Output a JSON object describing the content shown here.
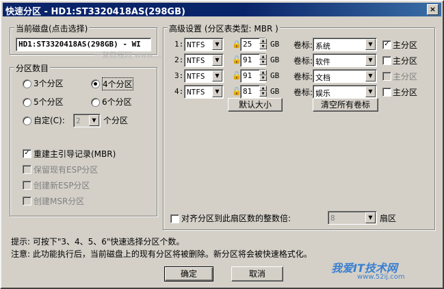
{
  "window": {
    "title": "快速分区 - HD1:ST3320418AS(298GB)",
    "close_glyph": "×"
  },
  "disk_group": {
    "legend": "当前磁盘(点击选择)",
    "value": "HD1:ST3320418AS(298GB) - WI"
  },
  "count_group": {
    "legend": "分区数目",
    "options": [
      "3个分区",
      "4个分区",
      "5个分区",
      "6个分区"
    ],
    "selected_index": 1,
    "custom_label": "自定(C):",
    "custom_value": "2",
    "custom_suffix": "个分区",
    "checks": [
      {
        "label": "重建主引导记录(MBR)",
        "checked": true,
        "enabled": true
      },
      {
        "label": "保留现有ESP分区",
        "checked": false,
        "enabled": false
      },
      {
        "label": "创建新ESP分区",
        "checked": false,
        "enabled": false
      },
      {
        "label": "创建MSR分区",
        "checked": false,
        "enabled": false
      }
    ]
  },
  "advanced": {
    "legend": "高级设置 (分区表类型: MBR )",
    "unit": "GB",
    "vol_label": "卷标:",
    "primary_label": "主分区",
    "rows": [
      {
        "num": "1:",
        "fs": "NTFS",
        "size": "25",
        "locked": true,
        "volume": "系统",
        "primary": true,
        "primary_enabled": true
      },
      {
        "num": "2:",
        "fs": "NTFS",
        "size": "91",
        "locked": false,
        "volume": "软件",
        "primary": false,
        "primary_enabled": true
      },
      {
        "num": "3:",
        "fs": "NTFS",
        "size": "91",
        "locked": false,
        "volume": "文档",
        "primary": false,
        "primary_enabled": false
      },
      {
        "num": "4:",
        "fs": "NTFS",
        "size": "81",
        "locked": false,
        "volume": "娱乐",
        "primary": false,
        "primary_enabled": true
      }
    ],
    "default_size_button": "默认大小",
    "clear_labels_button": "清空所有卷标",
    "align_label": "对齐分区到此扇区数的整数倍:",
    "align_value": "8",
    "align_suffix": "扇区"
  },
  "hints": {
    "line1": "提示: 可按下\"3、4、5、6\"快速选择分区个数。",
    "line2": "注意: 此功能执行后，当前磁盘上的现有分区将被删除。新分区将会被快速格式化。"
  },
  "buttons": {
    "ok": "确定",
    "cancel": "取消"
  },
  "watermarks": {
    "center": "一聚教程网 www.…",
    "brand": "我爱IT技术网",
    "url": "www.52ij.com"
  }
}
